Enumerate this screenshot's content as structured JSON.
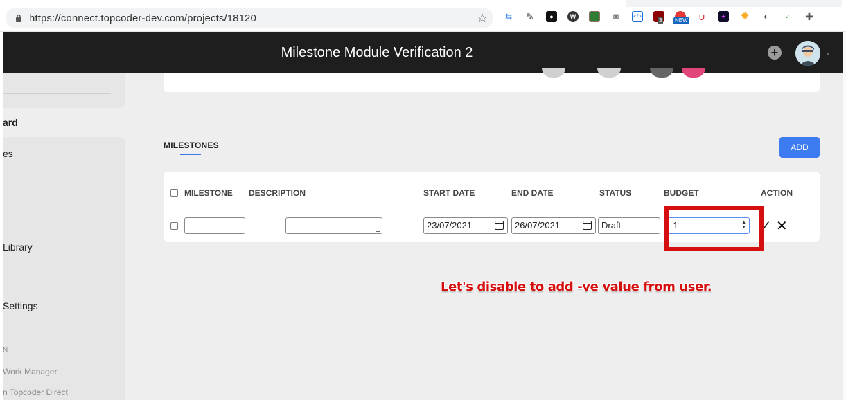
{
  "browser": {
    "url": "https://connect.topcoder-dev.com/projects/18120",
    "ext_badge_count": "3",
    "ext_badge_new": "NEW"
  },
  "header": {
    "title": "Milestone Module Verification 2"
  },
  "sidebar": {
    "items": [
      {
        "label": "ard"
      },
      {
        "label": "es"
      },
      {
        "label": "Library"
      },
      {
        "label": "Settings"
      }
    ],
    "section_label": "N",
    "links": [
      {
        "label": "Work Manager"
      },
      {
        "label": "n Topcoder Direct"
      }
    ]
  },
  "milestones": {
    "title": "MILESTONES",
    "add_label": "ADD",
    "columns": [
      "MILESTONE",
      "DESCRIPTION",
      "START DATE",
      "END DATE",
      "STATUS",
      "BUDGET",
      "ACTION"
    ],
    "row": {
      "milestone": "",
      "description": "",
      "start_date": "23/07/2021",
      "end_date": "26/07/2021",
      "status": "Draft",
      "budget": "-1",
      "confirm_symbol": "✓",
      "cancel_symbol": "✕"
    }
  },
  "annotation": {
    "text": "Let's disable to add -ve value from user.",
    "color": "#d50f0f"
  },
  "colors": {
    "header_bg": "#1e1e1e",
    "accent": "#3d7bf1",
    "page_bg": "#eeeeee"
  }
}
